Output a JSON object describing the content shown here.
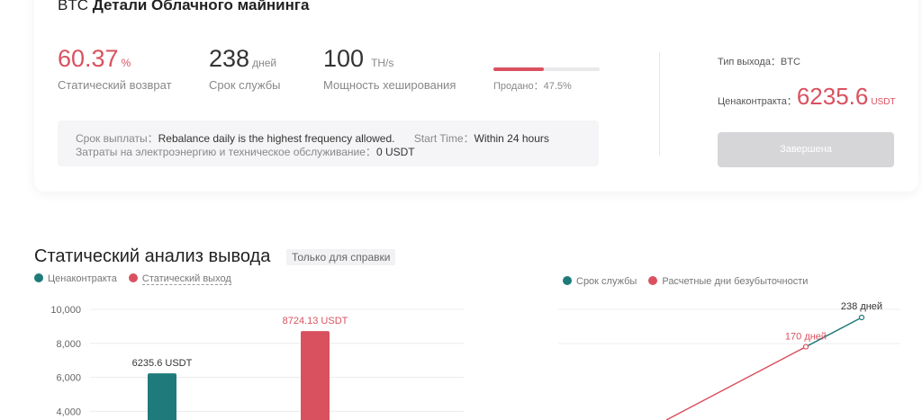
{
  "header": {
    "title_prefix": "BTC",
    "title_main": "Детали Облачного майнинга"
  },
  "stats": {
    "return_value": "60.37",
    "return_unit": "%",
    "return_label": "Статический возврат",
    "term_value": "238",
    "term_unit": "дней",
    "term_label": "Срок службы",
    "hash_value": "100",
    "hash_unit": "TH/s",
    "hash_label": "Мощность хеширования",
    "sold_label": "Продано：47.5%",
    "sold_fraction": 0.475
  },
  "info": {
    "payout_label": "Срок выплаты：",
    "payout_value": "Rebalance daily is the highest frequency allowed.",
    "start_label": "Start Time：",
    "start_value": "Within 24 hours",
    "costs_label": "Затраты на электроэнергию и техническое обслуживание：",
    "costs_value": "0 USDT"
  },
  "side": {
    "output_type": "Тип выхода：BTC",
    "price_label": "Ценаконтракта：",
    "price_value": "6235.6",
    "price_unit": "USDT",
    "button_label": "Завершена"
  },
  "section": {
    "title": "Статический анализ вывода",
    "tag": "Только для справки"
  },
  "colors": {
    "teal": "#1e7a7b",
    "red": "#d9515f"
  },
  "chart_data": [
    {
      "type": "bar",
      "legend": [
        "Ценаконтракта",
        "Статический выход"
      ],
      "categories": [
        "Ценаконтракта",
        "Статический выход"
      ],
      "values": [
        6235.6,
        8724.13
      ],
      "value_labels": [
        "6235.6 USDT",
        "8724.13 USDT"
      ],
      "ylim": [
        0,
        10000
      ],
      "yticks": [
        "10,000",
        "8,000",
        "6,000",
        "4,000"
      ],
      "ytick_values": [
        10000,
        8000,
        6000,
        4000
      ]
    },
    {
      "type": "line",
      "legend": [
        "Срок службы",
        "Расчетные дни безубыточности"
      ],
      "annotations": [
        "238 дней",
        "170 дней"
      ],
      "y_values": [
        238,
        170
      ]
    }
  ]
}
